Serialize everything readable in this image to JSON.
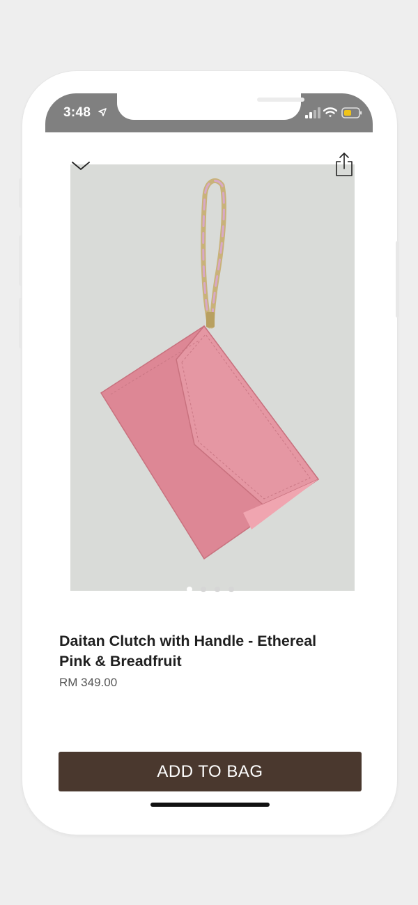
{
  "status_bar": {
    "time": "3:48",
    "icons": [
      "location-arrow-icon",
      "cellular-signal-icon",
      "wifi-icon",
      "battery-icon"
    ],
    "battery_color": "#f0c419"
  },
  "nav": {
    "icons": [
      "chevron-down-icon",
      "share-icon"
    ]
  },
  "product": {
    "image_background": "#d9dbd8",
    "bag_color": "#e08c98",
    "title": "Daitan Clutch with Handle - Ethereal Pink & Breadfruit",
    "price": "RM 349.00",
    "carousel": {
      "count": 4,
      "active": 1
    }
  },
  "actions": {
    "add_to_bag_label": "ADD TO BAG",
    "button_color": "#4a382e"
  }
}
